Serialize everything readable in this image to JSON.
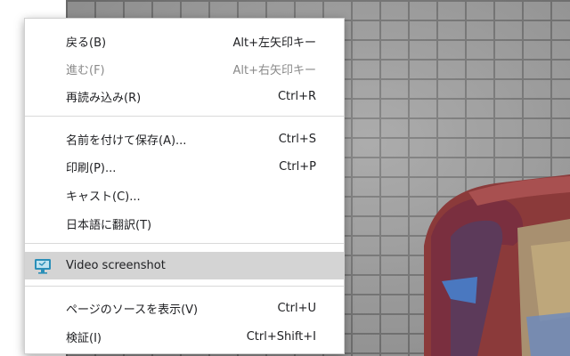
{
  "menu": {
    "back": {
      "label": "戻る(B)",
      "shortcut": "Alt+左矢印キー"
    },
    "forward": {
      "label": "進む(F)",
      "shortcut": "Alt+右矢印キー"
    },
    "reload": {
      "label": "再読み込み(R)",
      "shortcut": "Ctrl+R"
    },
    "save_as": {
      "label": "名前を付けて保存(A)...",
      "shortcut": "Ctrl+S"
    },
    "print": {
      "label": "印刷(P)...",
      "shortcut": "Ctrl+P"
    },
    "cast": {
      "label": "キャスト(C)..."
    },
    "translate": {
      "label": "日本語に翻訳(T)"
    },
    "video_screenshot": {
      "label": "Video screenshot",
      "icon": "monitor-icon"
    },
    "view_source": {
      "label": "ページのソースを表示(V)",
      "shortcut": "Ctrl+U"
    },
    "inspect": {
      "label": "検証(I)",
      "shortcut": "Ctrl+Shift+I"
    }
  },
  "colors": {
    "menu_bg": "#ffffff",
    "highlight": "#d4d4d4",
    "disabled_text": "#8a8a8a",
    "icon_accent": "#2a8fb8"
  }
}
